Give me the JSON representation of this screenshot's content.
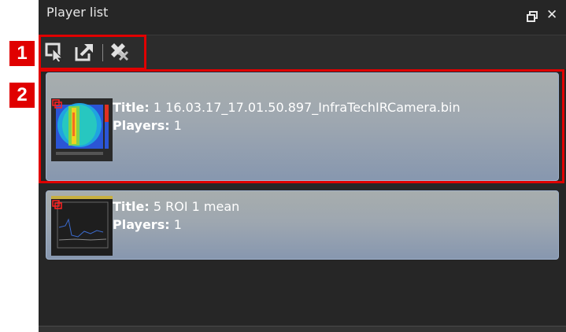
{
  "panel": {
    "title": "Player list",
    "restore_icon": "restore-window-icon",
    "close_label": "✕"
  },
  "toolbar": {
    "buttons": [
      {
        "icon": "select-player-icon"
      },
      {
        "icon": "open-external-icon"
      },
      {
        "icon": "close-all-players-icon"
      }
    ]
  },
  "players": [
    {
      "title_label": "Title:",
      "title": "1 16.03.17_17.01.50.897_InfraTechIRCamera.bin",
      "players_label": "Players:",
      "players": "1",
      "thumb": "ir-image-thumbnail"
    },
    {
      "title_label": "Title:",
      "title": "5 ROI 1 mean",
      "players_label": "Players:",
      "players": "1",
      "thumb": "plot-thumbnail"
    }
  ],
  "callouts": {
    "one": "1",
    "two": "2"
  },
  "colors": {
    "accent": "#e00000",
    "panel_bg": "#262626",
    "card_border": "#9fb2cc"
  }
}
